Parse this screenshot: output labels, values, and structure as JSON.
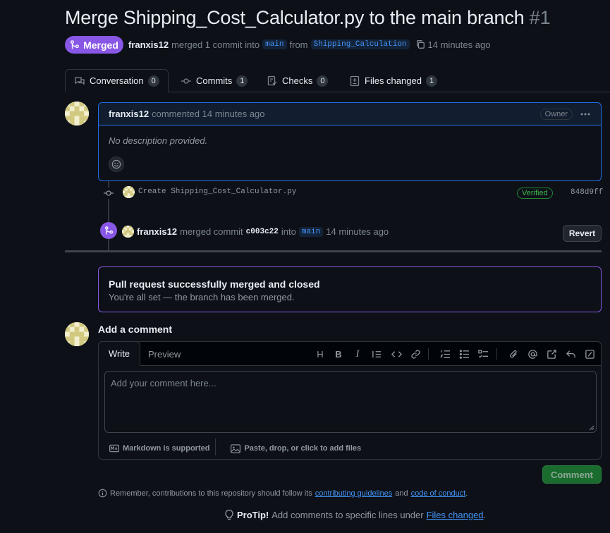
{
  "pr": {
    "title": "Merge Shipping_Cost_Calculator.py to the main branch",
    "number": "#1",
    "state": "Merged",
    "author": "franxis12",
    "merged_text": "merged 1 commit into",
    "base_branch": "main",
    "from_text": "from",
    "head_branch": "Shipping_Calculation",
    "time_ago": "14 minutes ago"
  },
  "tabs": [
    {
      "label": "Conversation",
      "count": "0",
      "icon": "comment-discussion-icon"
    },
    {
      "label": "Commits",
      "count": "1",
      "icon": "git-commit-icon"
    },
    {
      "label": "Checks",
      "count": "0",
      "icon": "checklist-icon"
    },
    {
      "label": "Files changed",
      "count": "1",
      "icon": "file-diff-icon"
    }
  ],
  "comment": {
    "author": "franxis12",
    "action": "commented 14 minutes ago",
    "role_badge": "Owner",
    "body": "No description provided."
  },
  "commit": {
    "message": "Create Shipping_Cost_Calculator.py",
    "verified": "Verified",
    "sha": "848d9ff"
  },
  "merge_event": {
    "author": "franxis12",
    "text": "merged commit",
    "sha": "c003c22",
    "into": "into",
    "branch": "main",
    "time_ago": "14 minutes ago",
    "revert_label": "Revert"
  },
  "merged_status": {
    "title": "Pull request successfully merged and closed",
    "subtitle": "You're all set — the branch has been merged."
  },
  "add_comment": {
    "title": "Add a comment",
    "tab_write": "Write",
    "tab_preview": "Preview",
    "placeholder": "Add your comment here...",
    "markdown_note": "Markdown is supported",
    "attach_note": "Paste, drop, or click to add files",
    "submit_label": "Comment"
  },
  "guidelines": {
    "prefix": "Remember, contributions to this repository should follow its",
    "link1": "contributing guidelines",
    "and": "and",
    "link2": "code of conduct",
    "suffix": "."
  },
  "protip": {
    "label": "ProTip!",
    "text": "Add comments to specific lines under",
    "link": "Files changed",
    "suffix": "."
  },
  "colors": {
    "background": "#0d1117",
    "merged_purple": "#8957e5",
    "link_blue": "#4493f8",
    "comment_green": "#196c2e"
  }
}
